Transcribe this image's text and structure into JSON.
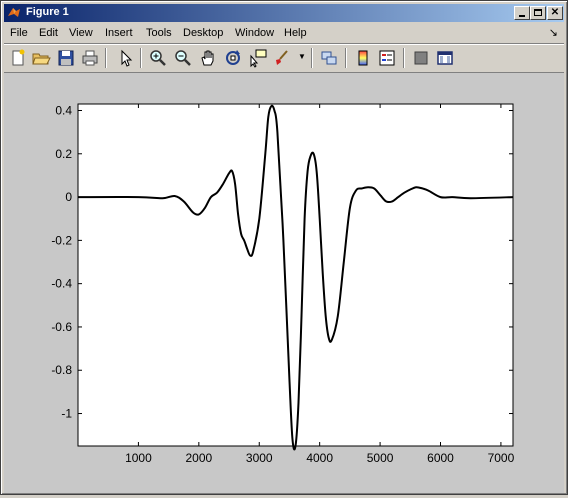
{
  "window": {
    "title": "Figure 1"
  },
  "menu": [
    "File",
    "Edit",
    "View",
    "Insert",
    "Tools",
    "Desktop",
    "Window",
    "Help"
  ],
  "toolbar": {
    "icons": [
      "new-figure-icon",
      "open-file-icon",
      "save-icon",
      "print-icon",
      "select-arrow-icon",
      "zoom-in-icon",
      "zoom-out-icon",
      "pan-hand-icon",
      "rotate-3d-icon",
      "data-cursor-icon",
      "brush-icon",
      "link-plot-icon",
      "colorbar-icon",
      "legend-icon",
      "hide-plot-tools-icon",
      "show-plot-tools-icon"
    ]
  },
  "chart_data": {
    "type": "line",
    "title": "",
    "xlabel": "",
    "ylabel": "",
    "xlim": [
      0,
      7200
    ],
    "ylim": [
      -1.15,
      0.43
    ],
    "xticks": [
      1000,
      2000,
      3000,
      4000,
      5000,
      6000,
      7000
    ],
    "yticks": [
      0.4,
      0.2,
      0,
      -0.2,
      -0.4,
      -0.6,
      -0.8,
      -1
    ],
    "ytick_labels": [
      "0.4",
      "0.2",
      "0",
      "-0.2",
      "-0.4",
      "-0.6",
      "-0.8",
      "-1"
    ],
    "grid": false,
    "series": [
      {
        "color": "#000000",
        "x": [
          0,
          1000,
          1400,
          1600,
          1750,
          1900,
          2000,
          2100,
          2200,
          2300,
          2400,
          2500,
          2550,
          2600,
          2650,
          2700,
          2750,
          2800,
          2850,
          2900,
          3000,
          3100,
          3150,
          3200,
          3250,
          3300,
          3400,
          3500,
          3550,
          3600,
          3650,
          3700,
          3750,
          3800,
          3850,
          3900,
          3950,
          4000,
          4050,
          4100,
          4150,
          4200,
          4300,
          4400,
          4500,
          4600,
          4700,
          4800,
          4900,
          5000,
          5100,
          5200,
          5300,
          5400,
          5500,
          5600,
          5700,
          5800,
          6000,
          6200,
          6500,
          7200
        ],
        "y": [
          0,
          0,
          -0.005,
          0.005,
          -0.02,
          -0.07,
          -0.08,
          -0.05,
          0.0,
          0.02,
          0.06,
          0.11,
          0.12,
          0.06,
          -0.08,
          -0.17,
          -0.2,
          -0.24,
          -0.27,
          -0.25,
          -0.1,
          0.2,
          0.37,
          0.42,
          0.4,
          0.3,
          -0.2,
          -0.85,
          -1.12,
          -1.15,
          -0.95,
          -0.55,
          -0.1,
          0.12,
          0.19,
          0.2,
          0.12,
          -0.1,
          -0.35,
          -0.55,
          -0.65,
          -0.66,
          -0.55,
          -0.3,
          -0.05,
          0.03,
          0.04,
          0.045,
          0.04,
          0.01,
          -0.02,
          -0.02,
          0.0,
          0.02,
          0.035,
          0.045,
          0.04,
          0.03,
          0.0,
          0.0,
          -0.005,
          0.0
        ]
      }
    ]
  }
}
